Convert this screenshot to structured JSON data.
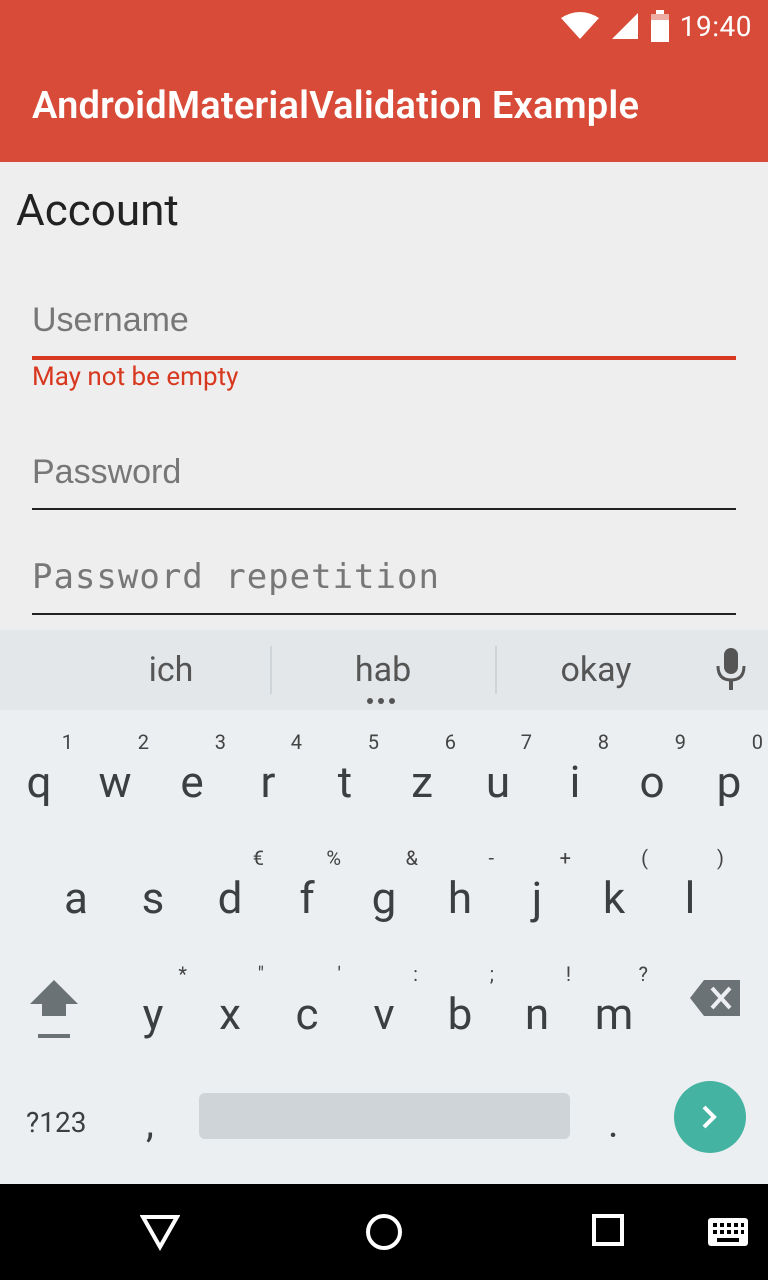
{
  "status_bar": {
    "time": "19:40",
    "icons": [
      "wifi-icon",
      "signal-icon",
      "battery-icon"
    ]
  },
  "app_bar": {
    "title": "AndroidMaterialValidation Example",
    "color": "#d84b38"
  },
  "form": {
    "section_title": "Account",
    "username": {
      "placeholder": "Username",
      "value": "",
      "error": "May not be empty"
    },
    "password": {
      "placeholder": "Password",
      "value": ""
    },
    "password_repetition": {
      "placeholder": "Password repetition",
      "value": ""
    }
  },
  "keyboard": {
    "suggestions": [
      "ich",
      "hab",
      "okay"
    ],
    "row1": [
      {
        "ch": "q",
        "hint": "1"
      },
      {
        "ch": "w",
        "hint": "2"
      },
      {
        "ch": "e",
        "hint": "3"
      },
      {
        "ch": "r",
        "hint": "4"
      },
      {
        "ch": "t",
        "hint": "5"
      },
      {
        "ch": "z",
        "hint": "6"
      },
      {
        "ch": "u",
        "hint": "7"
      },
      {
        "ch": "i",
        "hint": "8"
      },
      {
        "ch": "o",
        "hint": "9"
      },
      {
        "ch": "p",
        "hint": "0"
      }
    ],
    "row2": [
      {
        "ch": "a",
        "hint": ""
      },
      {
        "ch": "s",
        "hint": ""
      },
      {
        "ch": "d",
        "hint": "€"
      },
      {
        "ch": "f",
        "hint": "%"
      },
      {
        "ch": "g",
        "hint": "&"
      },
      {
        "ch": "h",
        "hint": "-"
      },
      {
        "ch": "j",
        "hint": "+"
      },
      {
        "ch": "k",
        "hint": "("
      },
      {
        "ch": "l",
        "hint": ")"
      }
    ],
    "row3": [
      {
        "ch": "y",
        "hint": "*"
      },
      {
        "ch": "x",
        "hint": "\""
      },
      {
        "ch": "c",
        "hint": "'"
      },
      {
        "ch": "v",
        "hint": ":"
      },
      {
        "ch": "b",
        "hint": ";"
      },
      {
        "ch": "n",
        "hint": "!"
      },
      {
        "ch": "m",
        "hint": "?"
      }
    ],
    "symbols_label": "?123",
    "comma": ",",
    "period": ".",
    "accent": "#44b3a1"
  },
  "nav_bar": {
    "buttons": [
      "back-triangle-icon",
      "home-circle-icon",
      "recents-square-icon",
      "keyboard-icon"
    ]
  }
}
